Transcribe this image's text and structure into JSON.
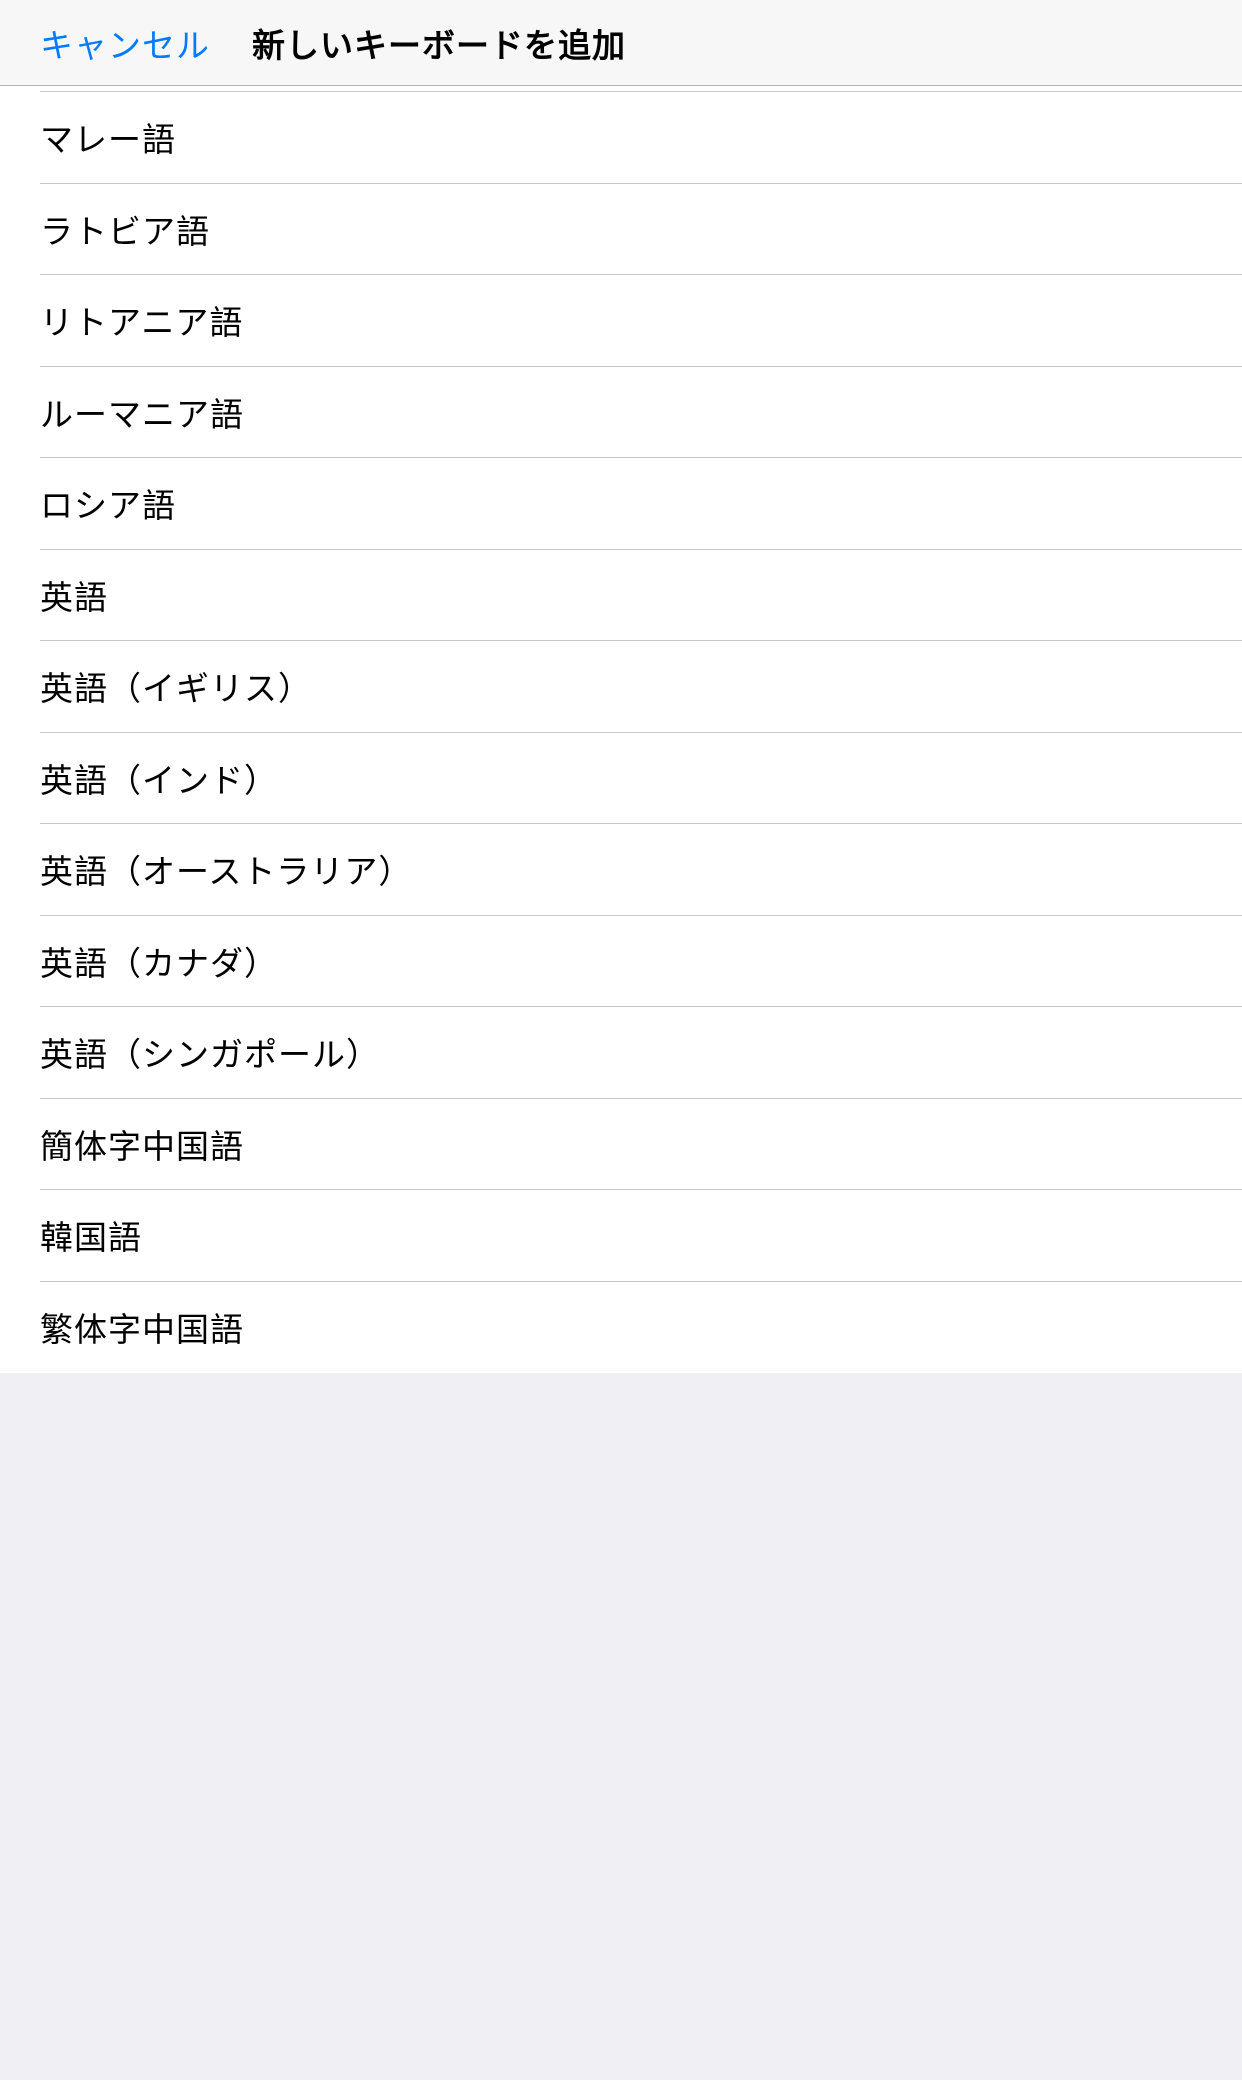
{
  "header": {
    "cancel_label": "キャンセル",
    "title": "新しいキーボードを追加"
  },
  "keyboards": [
    {
      "label": "マレー語"
    },
    {
      "label": "ラトビア語"
    },
    {
      "label": "リトアニア語"
    },
    {
      "label": "ルーマニア語"
    },
    {
      "label": "ロシア語"
    },
    {
      "label": "英語"
    },
    {
      "label": "英語（イギリス）"
    },
    {
      "label": "英語（インド）"
    },
    {
      "label": "英語（オーストラリア）"
    },
    {
      "label": "英語（カナダ）"
    },
    {
      "label": "英語（シンガポール）"
    },
    {
      "label": "簡体字中国語"
    },
    {
      "label": "韓国語"
    },
    {
      "label": "繁体字中国語"
    }
  ]
}
